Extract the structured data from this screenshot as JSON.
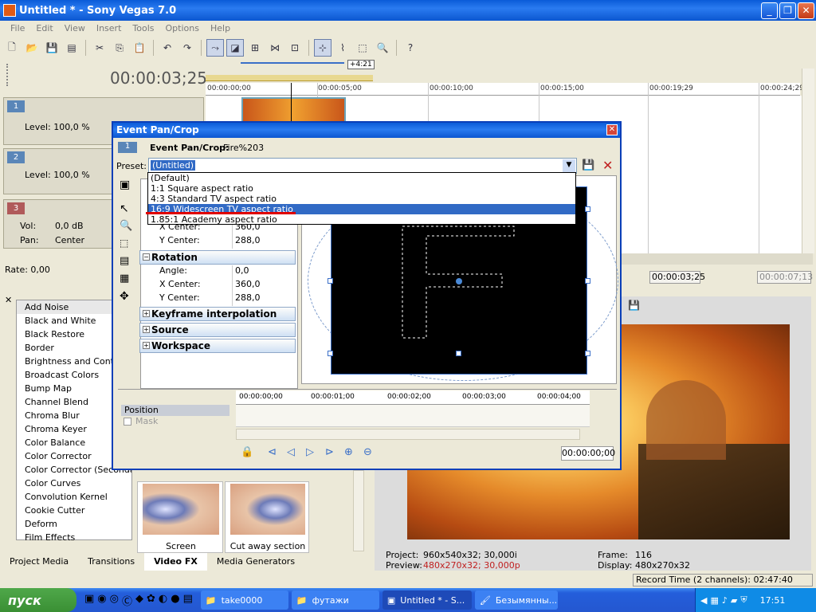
{
  "window": {
    "title": "Untitled * - Sony Vegas 7.0"
  },
  "menu": [
    "File",
    "Edit",
    "View",
    "Insert",
    "Tools",
    "Options",
    "Help"
  ],
  "timeline": {
    "cursor_time": "00:00:03;25",
    "ruler_labels": [
      "00:00:00;00",
      "00:00:05;00",
      "00:00:10;00",
      "00:00:15;00",
      "00:00:19;29",
      "00:00:24;29"
    ],
    "loop_region_label": "+4:21",
    "tracks": [
      {
        "number": "1",
        "level_label": "Level: 100,0 %"
      },
      {
        "number": "2",
        "level_label": "Level: 100,0 %"
      },
      {
        "number": "3",
        "vol_label": "Vol:",
        "vol_value": "0,0 dB",
        "pan_label": "Pan:",
        "pan_value": "Center"
      }
    ],
    "rate": "Rate: 0,00",
    "time_fields": [
      "00:00:03;25",
      "00:00:07;13"
    ]
  },
  "dialog": {
    "title": "Event Pan/Crop",
    "number": "1",
    "event_label": "Event Pan/Crop:",
    "event_name": "Fire%203",
    "preset_label": "Preset:",
    "preset_value": "(Untitled)",
    "preset_options": [
      "(Default)",
      "1:1 Square aspect ratio",
      "4:3 Standard TV aspect ratio",
      "16:9 Widescreen TV aspect ratio",
      "1.85:1 Academy aspect ratio"
    ],
    "preset_selected_index": 3,
    "properties": {
      "x_center_label": "X Center:",
      "x_center": "360,0",
      "y_center_label": "Y Center:",
      "y_center": "288,0",
      "rotation_title": "Rotation",
      "angle_label": "Angle:",
      "angle": "0,0",
      "rot_x_label": "X Center:",
      "rot_x": "360,0",
      "rot_y_label": "Y Center:",
      "rot_y": "288,0",
      "keyframe_title": "Keyframe interpolation",
      "source_title": "Source",
      "workspace_title": "Workspace"
    },
    "keyframe": {
      "ruler_labels": [
        "00:00:00;00",
        "00:00:01;00",
        "00:00:02;00",
        "00:00:03;00",
        "00:00:04;00"
      ],
      "tracks": [
        "Position",
        "Mask"
      ],
      "time": "00:00:00;00"
    }
  },
  "fx_list": [
    "Add Noise",
    "Black and White",
    "Black Restore",
    "Border",
    "Brightness and Contrast",
    "Broadcast Colors",
    "Bump Map",
    "Channel Blend",
    "Chroma Blur",
    "Chroma Keyer",
    "Color Balance",
    "Color Corrector",
    "Color Corrector (Secondary)",
    "Color Curves",
    "Convolution Kernel",
    "Cookie Cutter",
    "Deform",
    "Film Effects"
  ],
  "presets": [
    "Screen",
    "Cut away section"
  ],
  "tabs": [
    "Project Media",
    "Transitions",
    "Video FX",
    "Media Generators"
  ],
  "active_tab_index": 2,
  "preview": {
    "project_label": "Project:",
    "project_value": "960x540x32; 30,000i",
    "preview_label": "Preview:",
    "preview_value": "480x270x32; 30,000p",
    "frame_label": "Frame:",
    "frame_value": "116",
    "display_label": "Display:",
    "display_value": "480x270x32"
  },
  "status": {
    "record_time": "Record Time (2 channels): 02:47:40"
  },
  "taskbar": {
    "start": "пуск",
    "tasks": [
      "take0000",
      "футажи",
      "Untitled * - S...",
      "Безымянны..."
    ],
    "active_task_index": 2,
    "clock": "17:51"
  },
  "colors": {
    "accent": "#0a5bd8",
    "selection": "#316ac5",
    "annotation": "#e00000"
  }
}
